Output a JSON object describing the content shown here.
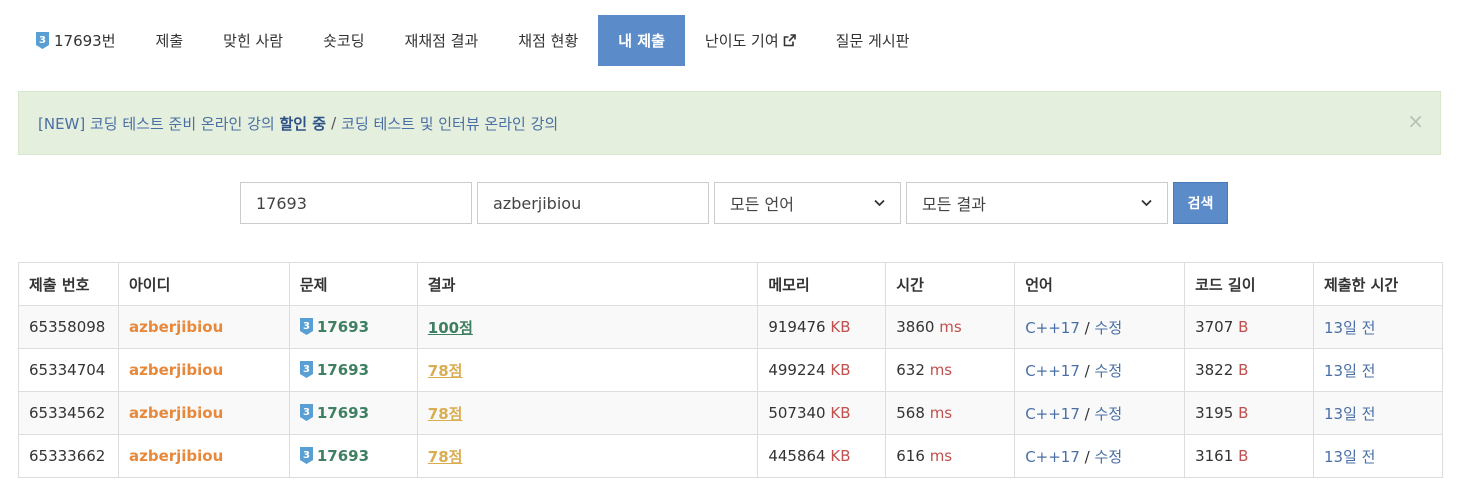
{
  "nav": {
    "problem_label": "17693번",
    "items": [
      "제출",
      "맞힌 사람",
      "숏코딩",
      "재채점 결과",
      "채점 현황",
      "내 제출",
      "난이도 기여",
      "질문 게시판"
    ],
    "active_index": 5
  },
  "alert": {
    "part1": "[NEW] 코딩 테스트 준비 온라인 강의",
    "bold": "할인 중",
    "separator": "/",
    "part2": "코딩 테스트 및 인터뷰 온라인 강의",
    "close": "×"
  },
  "search": {
    "problem_id": "17693",
    "user_id": "azberjibiou",
    "language": "모든 언어",
    "result": "모든 결과",
    "button": "검색"
  },
  "table": {
    "headers": [
      "제출 번호",
      "아이디",
      "문제",
      "결과",
      "메모리",
      "시간",
      "언어",
      "코드 길이",
      "제출한 시간"
    ],
    "rows": [
      {
        "id": "65358098",
        "user": "azberjibiou",
        "problem": "17693",
        "result": "100점",
        "memory": "919476",
        "time": "3860",
        "lang": "C++17",
        "edit": "수정",
        "length": "3707",
        "submitted": "13일 전"
      },
      {
        "id": "65334704",
        "user": "azberjibiou",
        "problem": "17693",
        "result": "78점",
        "memory": "499224",
        "time": "632",
        "lang": "C++17",
        "edit": "수정",
        "length": "3822",
        "submitted": "13일 전"
      },
      {
        "id": "65334562",
        "user": "azberjibiou",
        "problem": "17693",
        "result": "78점",
        "memory": "507340",
        "time": "568",
        "lang": "C++17",
        "edit": "수정",
        "length": "3195",
        "submitted": "13일 전"
      },
      {
        "id": "65333662",
        "user": "azberjibiou",
        "problem": "17693",
        "result": "78점",
        "memory": "445864",
        "time": "616",
        "lang": "C++17",
        "edit": "수정",
        "length": "3161",
        "submitted": "13일 전"
      }
    ],
    "units": {
      "memory": "KB",
      "time": "ms",
      "length": "B"
    },
    "tier_badge_text": "3"
  },
  "colors": {
    "accent": "#5b8bc9",
    "user": "#e8883a",
    "accepted": "#3f7f62",
    "partial": "#d9ad51",
    "unit": "#c0504d",
    "link": "#4a6fa5",
    "alert_bg": "#e5efdd"
  }
}
